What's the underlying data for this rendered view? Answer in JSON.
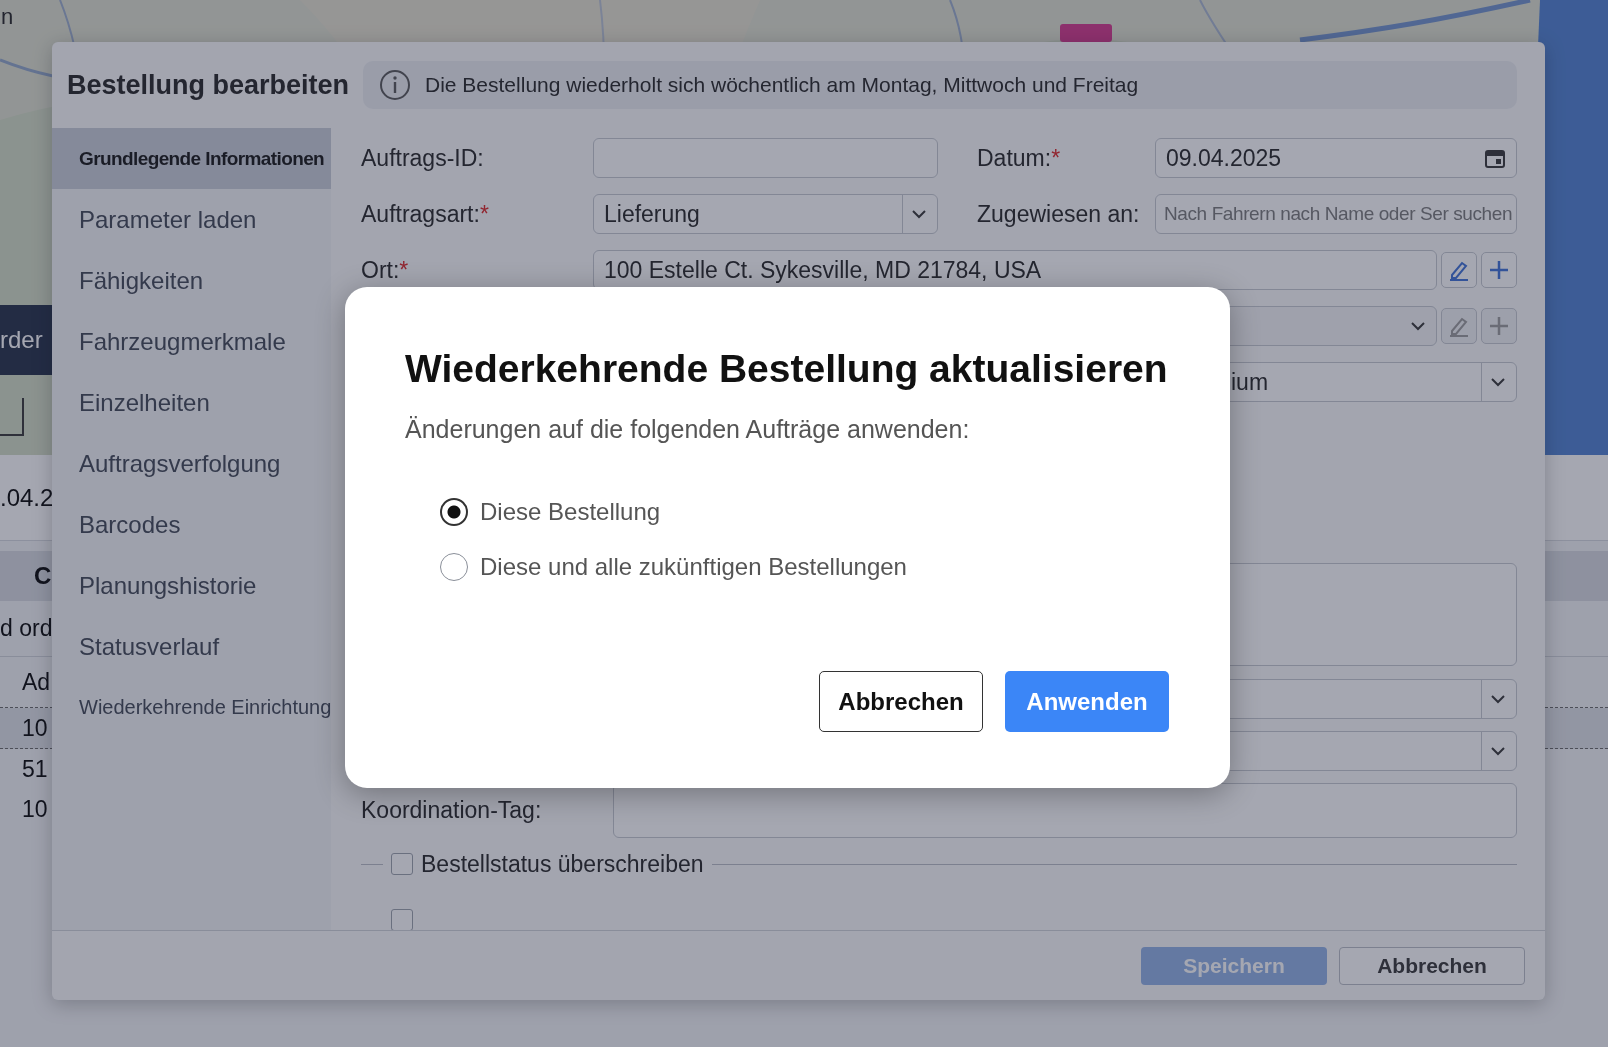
{
  "background": {
    "corner_text": "n",
    "button_text": "rder",
    "date": ".04.2",
    "column_heading": "C",
    "tab_text": "d ord",
    "table_heading": "Ad",
    "rows": [
      {
        "text": "10",
        "selected": true
      },
      {
        "text": "51",
        "selected": false
      },
      {
        "text": "10",
        "selected": false
      }
    ]
  },
  "edit_dialog": {
    "title": "Bestellung bearbeiten",
    "info": "Die Bestellung wiederholt sich wöchentlich am Montag, Mittwoch und Freitag",
    "sidebar": [
      {
        "label": "Grundlegende Informationen",
        "selected": true
      },
      {
        "label": "Parameter laden",
        "selected": false
      },
      {
        "label": "Fähigkeiten",
        "selected": false
      },
      {
        "label": "Fahrzeugmerkmale",
        "selected": false
      },
      {
        "label": "Einzelheiten",
        "selected": false
      },
      {
        "label": "Auftragsverfolgung",
        "selected": false
      },
      {
        "label": "Barcodes",
        "selected": false
      },
      {
        "label": "Planungshistorie",
        "selected": false
      },
      {
        "label": "Statusverlauf",
        "selected": false
      },
      {
        "label": "Wiederkehrende Einrichtung",
        "selected": false
      }
    ],
    "order_id": {
      "label": "Auftrags-ID:"
    },
    "date": {
      "label": "Datum:",
      "required_mark": "*",
      "value": "09.04.2025"
    },
    "order_type": {
      "label": "Auftragsart:",
      "required_mark": "*",
      "value": "Lieferung"
    },
    "assigned_to": {
      "label": "Zugewiesen an:",
      "placeholder": "Nach Fahrern nach Name oder Ser suchen"
    },
    "location": {
      "label": "Ort:",
      "required_mark": "*",
      "value": "100 Estelle Ct. Sykesville, MD 21784, USA"
    },
    "field_5": {
      "value": "ium"
    },
    "coordination_tag": {
      "label": "Koordination-Tag:"
    },
    "checkboxes": [
      {
        "label": "Bestellstatus überschreiben",
        "checked": false
      },
      {
        "checked": false
      }
    ],
    "footer_buttons": [
      {
        "label": "Speichern",
        "kind": "primary",
        "disabled": true
      },
      {
        "label": "Abbrechen",
        "kind": "secondary",
        "disabled": false
      }
    ]
  },
  "modal": {
    "title": "Wiederkehrende Bestellung aktualisieren",
    "subtitle": "Änderungen auf die folgenden Aufträge anwenden:",
    "options": [
      {
        "label": "Diese Bestellung",
        "selected": true
      },
      {
        "label": "Diese und alle zukünftigen Bestellungen",
        "selected": false
      }
    ],
    "buttons": [
      {
        "label": "Abbrechen",
        "kind": "secondary"
      },
      {
        "label": "Anwenden",
        "kind": "primary"
      }
    ]
  }
}
